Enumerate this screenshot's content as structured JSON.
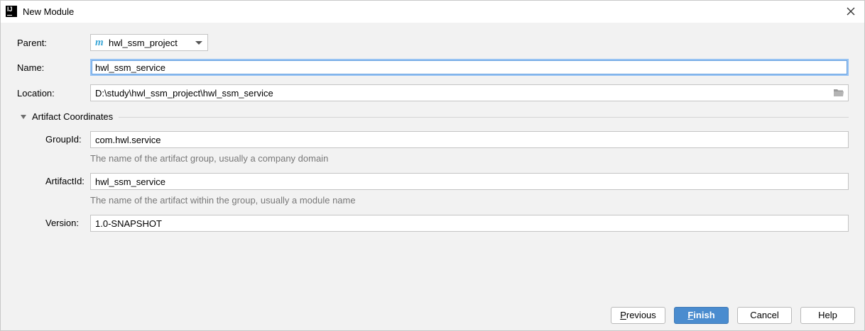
{
  "window": {
    "title": "New Module"
  },
  "form": {
    "parent": {
      "label": "Parent:",
      "value": "hwl_ssm_project"
    },
    "name": {
      "label": "Name:",
      "value": "hwl_ssm_service"
    },
    "location": {
      "label": "Location:",
      "value": "D:\\study\\hwl_ssm_project\\hwl_ssm_service"
    }
  },
  "artifact": {
    "section_label": "Artifact Coordinates",
    "group_id": {
      "label": "GroupId:",
      "value": "com.hwl.service",
      "hint": "The name of the artifact group, usually a company domain"
    },
    "artifact_id": {
      "label": "ArtifactId:",
      "value": "hwl_ssm_service",
      "hint": "The name of the artifact within the group, usually a module name"
    },
    "version": {
      "label": "Version:",
      "value": "1.0-SNAPSHOT"
    }
  },
  "buttons": {
    "previous": {
      "mnemonic": "P",
      "rest": "revious"
    },
    "finish": {
      "mnemonic": "F",
      "rest": "inish"
    },
    "cancel": "Cancel",
    "help": "Help"
  },
  "icons": {
    "app": "intellij-idea-icon",
    "close": "close-icon",
    "parent_module": "maven-module-icon",
    "dropdown": "chevron-down-icon",
    "browse": "folder-icon",
    "collapse": "triangle-down-icon"
  },
  "colors": {
    "primary_button": "#4a8ccf",
    "focus_border": "#97c3f3",
    "maven_icon": "#3fa9d8",
    "hint_text": "#787878"
  }
}
